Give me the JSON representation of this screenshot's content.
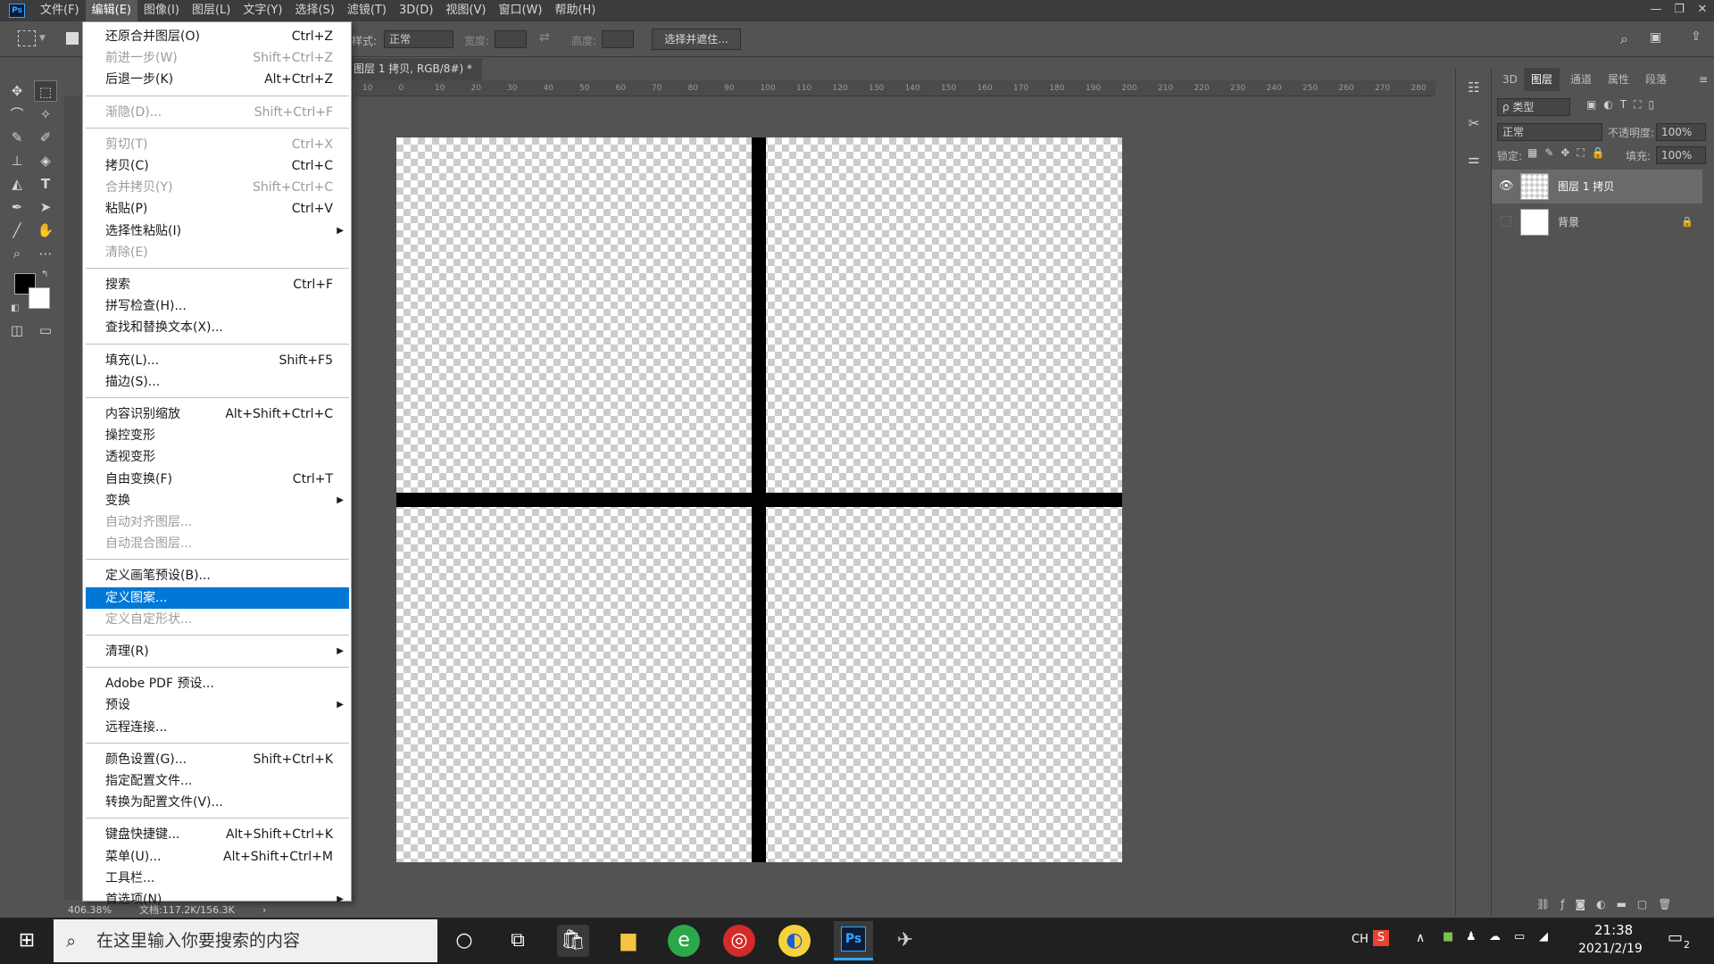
{
  "app": {
    "logo": "Ps",
    "menubar": [
      "文件(F)",
      "编辑(E)",
      "图像(I)",
      "图层(L)",
      "文字(Y)",
      "选择(S)",
      "滤镜(T)",
      "3D(D)",
      "视图(V)",
      "窗口(W)",
      "帮助(H)"
    ],
    "window_controls": [
      "—",
      "❐",
      "✕"
    ]
  },
  "options": {
    "style_label": "样式:",
    "style_value": "正常",
    "width_label": "宽度:",
    "height_label": "高度:",
    "select_mask_label": "选择并遮住..."
  },
  "document": {
    "tab_label": "图层 1 拷贝, RGB/8#) *",
    "tab_close": "×",
    "zoom": "406.38%",
    "doc_info": "文档:117.2K/156.3K",
    "status_arrow": "›"
  },
  "ruler": {
    "ticks": [
      "10",
      "0",
      "10",
      "20",
      "30",
      "40",
      "50",
      "60",
      "70",
      "80",
      "90",
      "100",
      "110",
      "120",
      "130",
      "140",
      "150",
      "160",
      "170",
      "180",
      "190",
      "200",
      "210",
      "220",
      "230",
      "240",
      "250",
      "260",
      "270",
      "280"
    ]
  },
  "edit_menu": {
    "items": [
      {
        "label": "还原合并图层(O)",
        "shortcut": "Ctrl+Z",
        "disabled": false
      },
      {
        "label": "前进一步(W)",
        "shortcut": "Shift+Ctrl+Z",
        "disabled": true
      },
      {
        "label": "后退一步(K)",
        "shortcut": "Alt+Ctrl+Z",
        "disabled": false
      },
      {
        "label": "渐隐(D)...",
        "shortcut": "Shift+Ctrl+F",
        "disabled": true
      },
      {
        "label": "剪切(T)",
        "shortcut": "Ctrl+X",
        "disabled": true
      },
      {
        "label": "拷贝(C)",
        "shortcut": "Ctrl+C",
        "disabled": false
      },
      {
        "label": "合并拷贝(Y)",
        "shortcut": "Shift+Ctrl+C",
        "disabled": true
      },
      {
        "label": "粘贴(P)",
        "shortcut": "Ctrl+V",
        "disabled": false
      },
      {
        "label": "选择性粘贴(I)",
        "shortcut": "",
        "disabled": false,
        "submenu": true
      },
      {
        "label": "清除(E)",
        "shortcut": "",
        "disabled": true
      },
      {
        "label": "搜索",
        "shortcut": "Ctrl+F",
        "disabled": false
      },
      {
        "label": "拼写检查(H)...",
        "shortcut": "",
        "disabled": false
      },
      {
        "label": "查找和替换文本(X)...",
        "shortcut": "",
        "disabled": false
      },
      {
        "label": "填充(L)...",
        "shortcut": "Shift+F5",
        "disabled": false
      },
      {
        "label": "描边(S)...",
        "shortcut": "",
        "disabled": false
      },
      {
        "label": "内容识别缩放",
        "shortcut": "Alt+Shift+Ctrl+C",
        "disabled": false
      },
      {
        "label": "操控变形",
        "shortcut": "",
        "disabled": false
      },
      {
        "label": "透视变形",
        "shortcut": "",
        "disabled": false
      },
      {
        "label": "自由变换(F)",
        "shortcut": "Ctrl+T",
        "disabled": false
      },
      {
        "label": "变换",
        "shortcut": "",
        "disabled": false,
        "submenu": true
      },
      {
        "label": "自动对齐图层...",
        "shortcut": "",
        "disabled": true
      },
      {
        "label": "自动混合图层...",
        "shortcut": "",
        "disabled": true
      },
      {
        "label": "定义画笔预设(B)...",
        "shortcut": "",
        "disabled": false
      },
      {
        "label": "定义图案...",
        "shortcut": "",
        "disabled": false,
        "highlighted": true
      },
      {
        "label": "定义自定形状...",
        "shortcut": "",
        "disabled": true
      },
      {
        "label": "清理(R)",
        "shortcut": "",
        "disabled": false,
        "submenu": true
      },
      {
        "label": "Adobe PDF 预设...",
        "shortcut": "",
        "disabled": false
      },
      {
        "label": "预设",
        "shortcut": "",
        "disabled": false,
        "submenu": true
      },
      {
        "label": "远程连接...",
        "shortcut": "",
        "disabled": false
      },
      {
        "label": "颜色设置(G)...",
        "shortcut": "Shift+Ctrl+K",
        "disabled": false
      },
      {
        "label": "指定配置文件...",
        "shortcut": "",
        "disabled": false
      },
      {
        "label": "转换为配置文件(V)...",
        "shortcut": "",
        "disabled": false
      },
      {
        "label": "键盘快捷键...",
        "shortcut": "Alt+Shift+Ctrl+K",
        "disabled": false
      },
      {
        "label": "菜单(U)...",
        "shortcut": "Alt+Shift+Ctrl+M",
        "disabled": false
      },
      {
        "label": "工具栏...",
        "shortcut": "",
        "disabled": false
      },
      {
        "label": "首选项(N)",
        "shortcut": "",
        "disabled": false,
        "submenu": true
      }
    ]
  },
  "layers_panel": {
    "tabs": [
      "3D",
      "图层",
      "通道",
      "属性",
      "段落"
    ],
    "active_tab": "图层",
    "filter_label": "ρ 类型",
    "blend_mode": "正常",
    "opacity_label": "不透明度:",
    "opacity_value": "100%",
    "lock_label": "锁定:",
    "fill_label": "填充:",
    "fill_value": "100%",
    "layers": [
      {
        "name": "图层 1 拷贝",
        "visible": true,
        "selected": true
      },
      {
        "name": "背景",
        "visible": false,
        "locked": true
      }
    ]
  },
  "taskbar": {
    "search_placeholder": "在这里输入你要搜索的内容",
    "tray_ime": "CH",
    "time": "21:38",
    "date": "2021/2/19",
    "notification_count": "2",
    "ps_label": "Ps"
  },
  "colors": {
    "highlight": "#0078d7",
    "ps_blue": "#31a8ff",
    "panel_bg": "#535353",
    "menubar_bg": "#3c3c3c"
  }
}
